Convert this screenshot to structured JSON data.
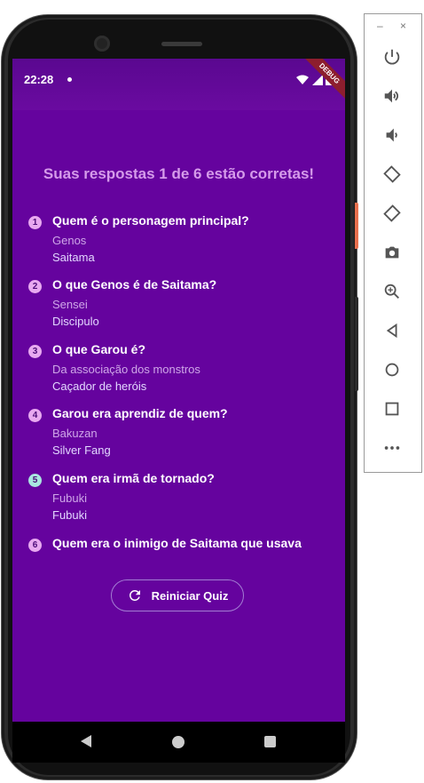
{
  "status_bar": {
    "time": "22:28",
    "debug_label": "DEBUG"
  },
  "quiz": {
    "result_title": "Suas respostas 1 de 6 estão corretas!",
    "items": [
      {
        "number": "1",
        "question": "Quem é o personagem principal?",
        "user_answer": "Genos",
        "correct_answer": "Saitama",
        "badge_color": "#e8a9f0"
      },
      {
        "number": "2",
        "question": "O que Genos é de Saitama?",
        "user_answer": "Sensei",
        "correct_answer": "Discipulo",
        "badge_color": "#e8a9f0"
      },
      {
        "number": "3",
        "question": "O que Garou é?",
        "user_answer": "Da associação dos monstros",
        "correct_answer": "Caçador de heróis",
        "badge_color": "#e8a9f0"
      },
      {
        "number": "4",
        "question": "Garou era aprendiz de quem?",
        "user_answer": "Bakuzan",
        "correct_answer": "Silver Fang",
        "badge_color": "#e8a9f0"
      },
      {
        "number": "5",
        "question": "Quem era irmã de tornado?",
        "user_answer": "Fubuki",
        "correct_answer": "Fubuki",
        "badge_color": "#a9e6e0"
      },
      {
        "number": "6",
        "question": "Quem era o inimigo de Saitama que usava",
        "user_answer": "",
        "correct_answer": "",
        "badge_color": "#e8a9f0"
      }
    ],
    "restart_label": "Reiniciar Quiz"
  },
  "emulator_toolbar": {
    "minimize_label": "–",
    "close_label": "×",
    "buttons": [
      "power-icon",
      "volume-up-icon",
      "volume-down-icon",
      "rotate-left-icon",
      "rotate-right-icon",
      "camera-icon",
      "zoom-icon",
      "back-icon",
      "home-icon",
      "overview-icon",
      "more-icon"
    ]
  }
}
